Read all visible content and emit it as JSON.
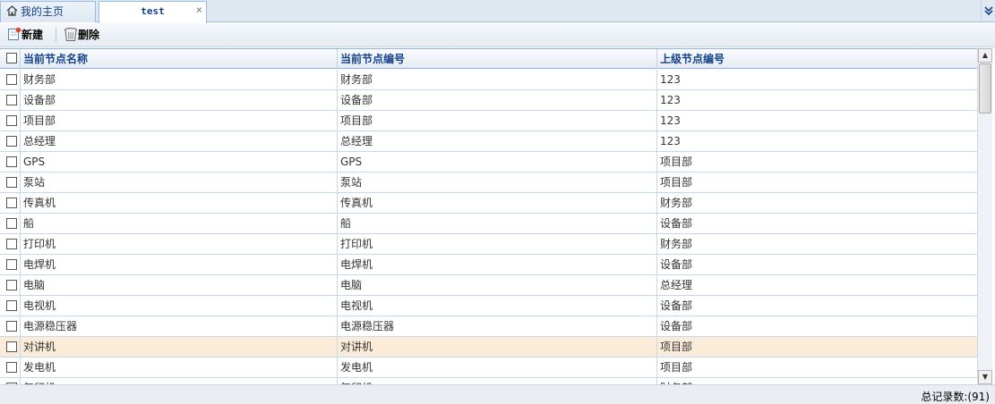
{
  "tabs": {
    "home_label": "我的主页",
    "active_label": "test",
    "close_glyph": "×",
    "menu_glyph": "❯"
  },
  "toolbar": {
    "new_label": "新建",
    "delete_label": "删除"
  },
  "grid": {
    "columns": [
      "当前节点名称",
      "当前节点编号",
      "上级节点编号"
    ],
    "rows": [
      {
        "name": "财务部",
        "code": "财务部",
        "parent": "123"
      },
      {
        "name": "设备部",
        "code": "设备部",
        "parent": "123"
      },
      {
        "name": "项目部",
        "code": "项目部",
        "parent": "123"
      },
      {
        "name": "总经理",
        "code": "总经理",
        "parent": "123"
      },
      {
        "name": "GPS",
        "code": "GPS",
        "parent": "项目部"
      },
      {
        "name": "泵站",
        "code": "泵站",
        "parent": "项目部"
      },
      {
        "name": "传真机",
        "code": "传真机",
        "parent": "财务部"
      },
      {
        "name": "船",
        "code": "船",
        "parent": "设备部"
      },
      {
        "name": "打印机",
        "code": "打印机",
        "parent": "财务部"
      },
      {
        "name": "电焊机",
        "code": "电焊机",
        "parent": "设备部"
      },
      {
        "name": "电脑",
        "code": "电脑",
        "parent": "总经理"
      },
      {
        "name": "电视机",
        "code": "电视机",
        "parent": "设备部"
      },
      {
        "name": "电源稳压器",
        "code": "电源稳压器",
        "parent": "设备部"
      },
      {
        "name": "对讲机",
        "code": "对讲机",
        "parent": "项目部",
        "selected": true
      },
      {
        "name": "发电机",
        "code": "发电机",
        "parent": "项目部"
      },
      {
        "name": "复印机",
        "code": "复印机",
        "parent": "财务部"
      }
    ]
  },
  "footer": {
    "total_label": "总记录数:(91)"
  },
  "colors": {
    "header_text": "#15428b",
    "selected_row": "#fbecd9",
    "grid_line": "#c5d9ee"
  }
}
